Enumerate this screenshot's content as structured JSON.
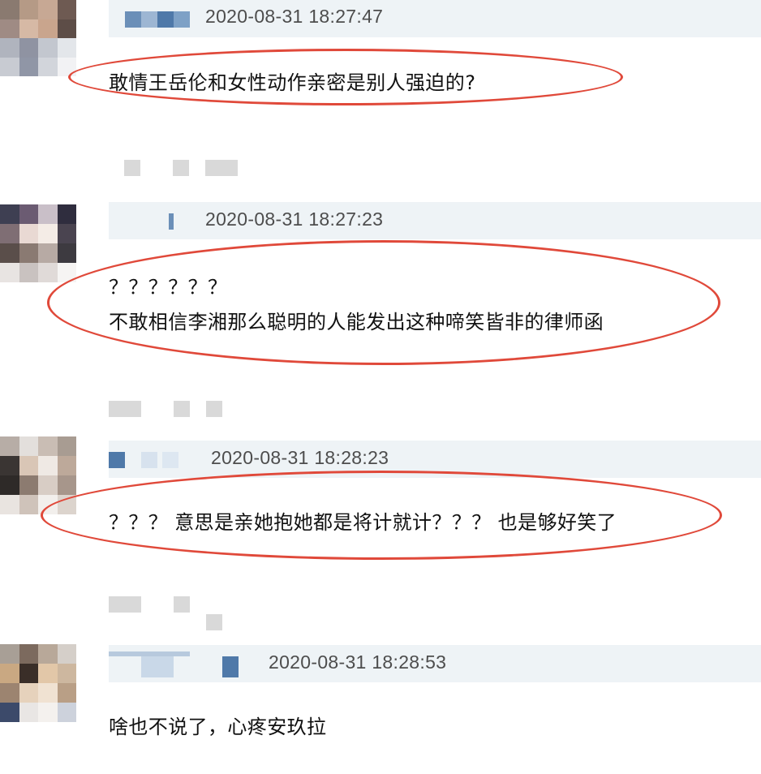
{
  "comments": [
    {
      "timestamp": "2020-08-31 18:27:47",
      "text_lines": [
        "敢情王岳伦和女性动作亲密是别人强迫的?"
      ],
      "avatar_colors": [
        "#8a7a70",
        "#b59a86",
        "#c7a894",
        "#6e5a52",
        "#9f8b84",
        "#d6b9a5",
        "#c9a58d",
        "#5d4d47",
        "#b0b4be",
        "#8f93a2",
        "#c3c7cf",
        "#e3e6ea",
        "#c8cbd2",
        "#9096a6",
        "#d2d5db",
        "#f2f2f4"
      ]
    },
    {
      "timestamp": "2020-08-31 18:27:23",
      "text_lines": [
        "？？？？？？",
        "不敢相信李湘那么聪明的人能发出这种啼笑皆非的律师函"
      ],
      "avatar_colors": [
        "#3e3f52",
        "#6b5b72",
        "#c9bfc8",
        "#2f2d3e",
        "#7f6e74",
        "#e9d9d3",
        "#f4ece6",
        "#4a4450",
        "#5a4e4a",
        "#8a7a72",
        "#b7aaa4",
        "#3d3a40",
        "#e8e4e2",
        "#c9c2c0",
        "#e0dad8",
        "#f6f4f3"
      ]
    },
    {
      "timestamp": "2020-08-31 18:28:23",
      "text_lines": [
        "？？？ 意思是亲她抱她都是将计就计？？？ 也是够好笑了"
      ],
      "avatar_colors": [
        "#b7ada6",
        "#e3dfdc",
        "#c9bdb4",
        "#a89c92",
        "#3a3533",
        "#d9c6b6",
        "#efe9e4",
        "#bda99a",
        "#2e2a28",
        "#8c7b70",
        "#d8cdc5",
        "#a7968b",
        "#e9e4e0",
        "#cfc3ba",
        "#f2efec",
        "#dcd4cd"
      ]
    },
    {
      "timestamp": "2020-08-31 18:28:53",
      "text_lines": [
        "啥也不说了，心疼安玖拉"
      ],
      "avatar_colors": [
        "#a89f96",
        "#7c6a5e",
        "#b8a899",
        "#d5cfc9",
        "#c9a882",
        "#3a2e28",
        "#e2c7a8",
        "#cdb79f",
        "#9c8470",
        "#e6d2bc",
        "#f0e2d2",
        "#b99f86",
        "#3c4a6a",
        "#e9e6e4",
        "#f4f1ee",
        "#cdd2dc"
      ]
    }
  ],
  "colors": {
    "ring": "#e0493a",
    "header_bar": "#eef3f6",
    "timestamp": "#4d4d4d",
    "text": "#111111"
  }
}
